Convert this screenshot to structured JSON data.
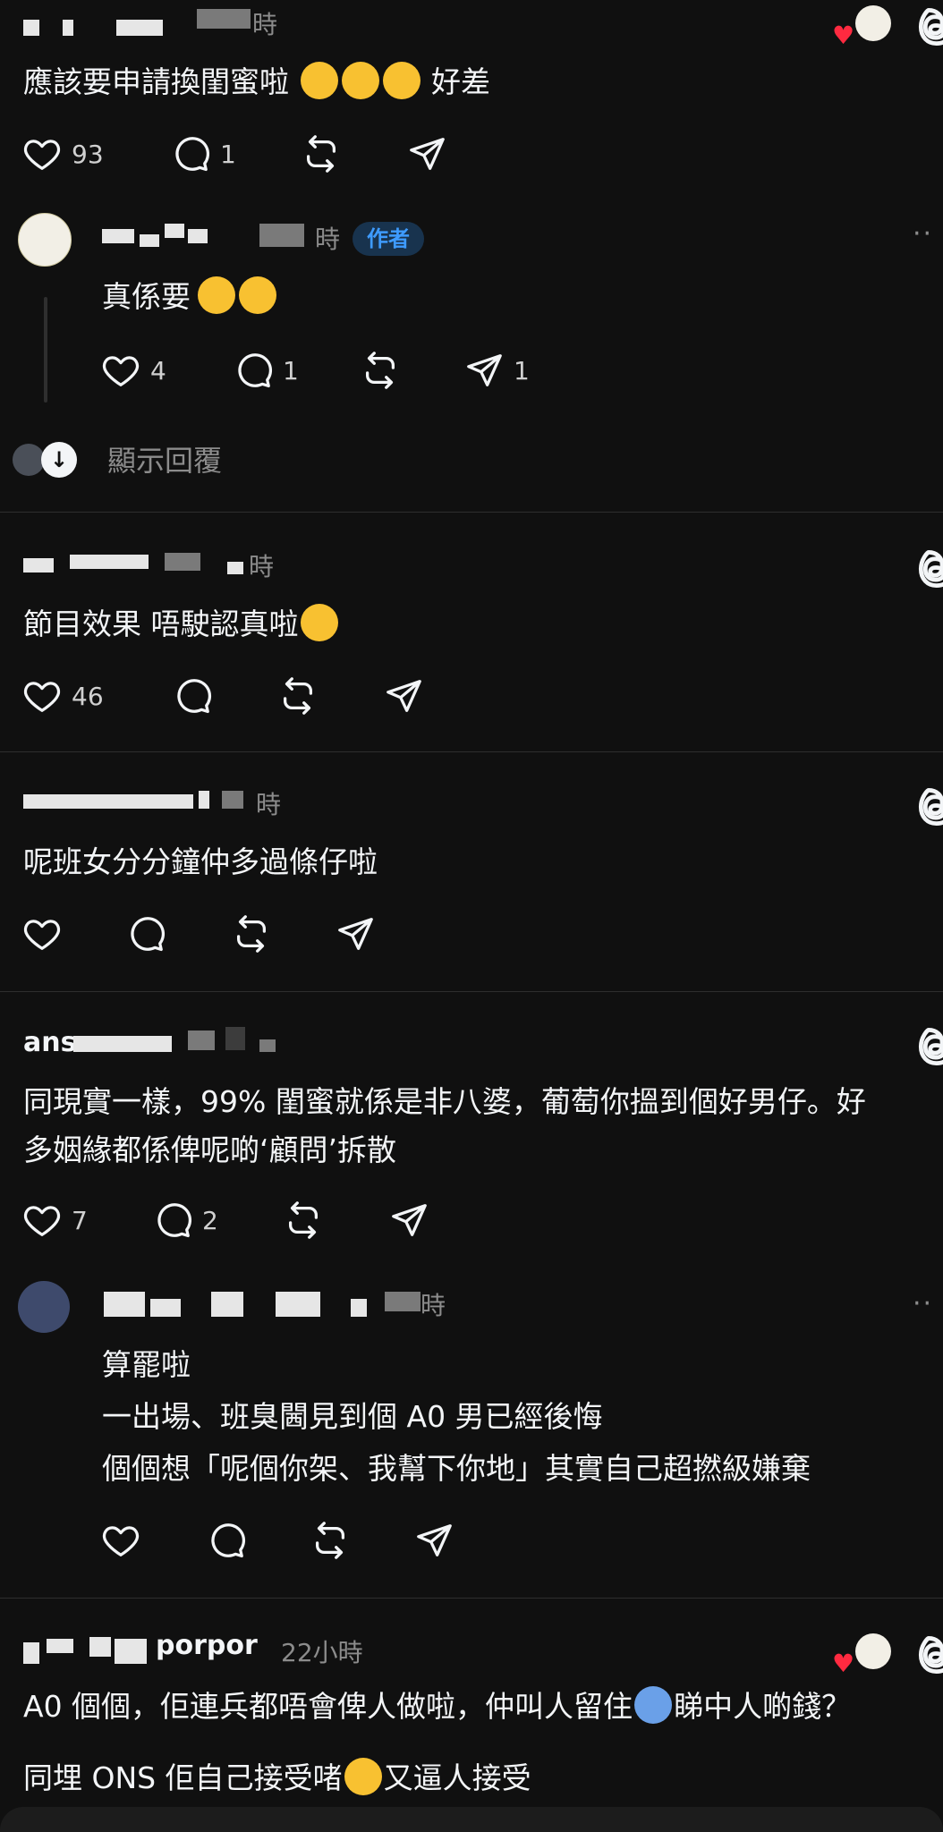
{
  "comments": [
    {
      "time": "時",
      "text": "應該要申請換閨蜜啦",
      "text_after_emoji": "好差",
      "likes": "93",
      "replies": "1"
    },
    {
      "badge": "作者",
      "time": "時",
      "text": "真係要",
      "likes": "4",
      "replies": "1",
      "shares": "1"
    },
    {
      "show_replies": "顯示回覆"
    },
    {
      "time": "時",
      "text": "節目效果 唔駛認真啦",
      "likes": "46"
    },
    {
      "time": "時",
      "text": "呢班女分分鐘仲多過條仔啦"
    },
    {
      "username_visible": "ans",
      "line1": "同現實一樣，99% 閨蜜就係是非八婆，葡萄你搵到個好男仔。好",
      "line2": "多姻緣都係俾呢啲‘顧問’拆散",
      "likes": "7",
      "replies": "2"
    },
    {
      "time": "時",
      "line1": "算罷啦",
      "line2": "一出場、班臭閪見到個 A0 男已經後悔",
      "line3": "個個想「呢個你架、我幫下你地」其實自己超撚級嫌棄"
    },
    {
      "username_visible": "porpor",
      "time": "22小時",
      "line1_a": "A0 個個，佢連兵都唔會俾人做啦，仲叫人留住",
      "line1_b": "睇中人啲錢？",
      "line2_a": "同埋 ONS 佢自己接受啫",
      "line2_b": "又逼人接受"
    }
  ],
  "icons": [
    "heart-icon",
    "comment-icon",
    "repost-icon",
    "share-icon",
    "threads-logo-icon",
    "more-icon",
    "expand-down-icon"
  ],
  "colors": {
    "background": "#101010",
    "text": "#f3f5f7",
    "muted": "#8c8c8c",
    "badge_text": "#3e9bff",
    "badge_bg": "#18334e",
    "like_heart": "#ff2a40"
  }
}
